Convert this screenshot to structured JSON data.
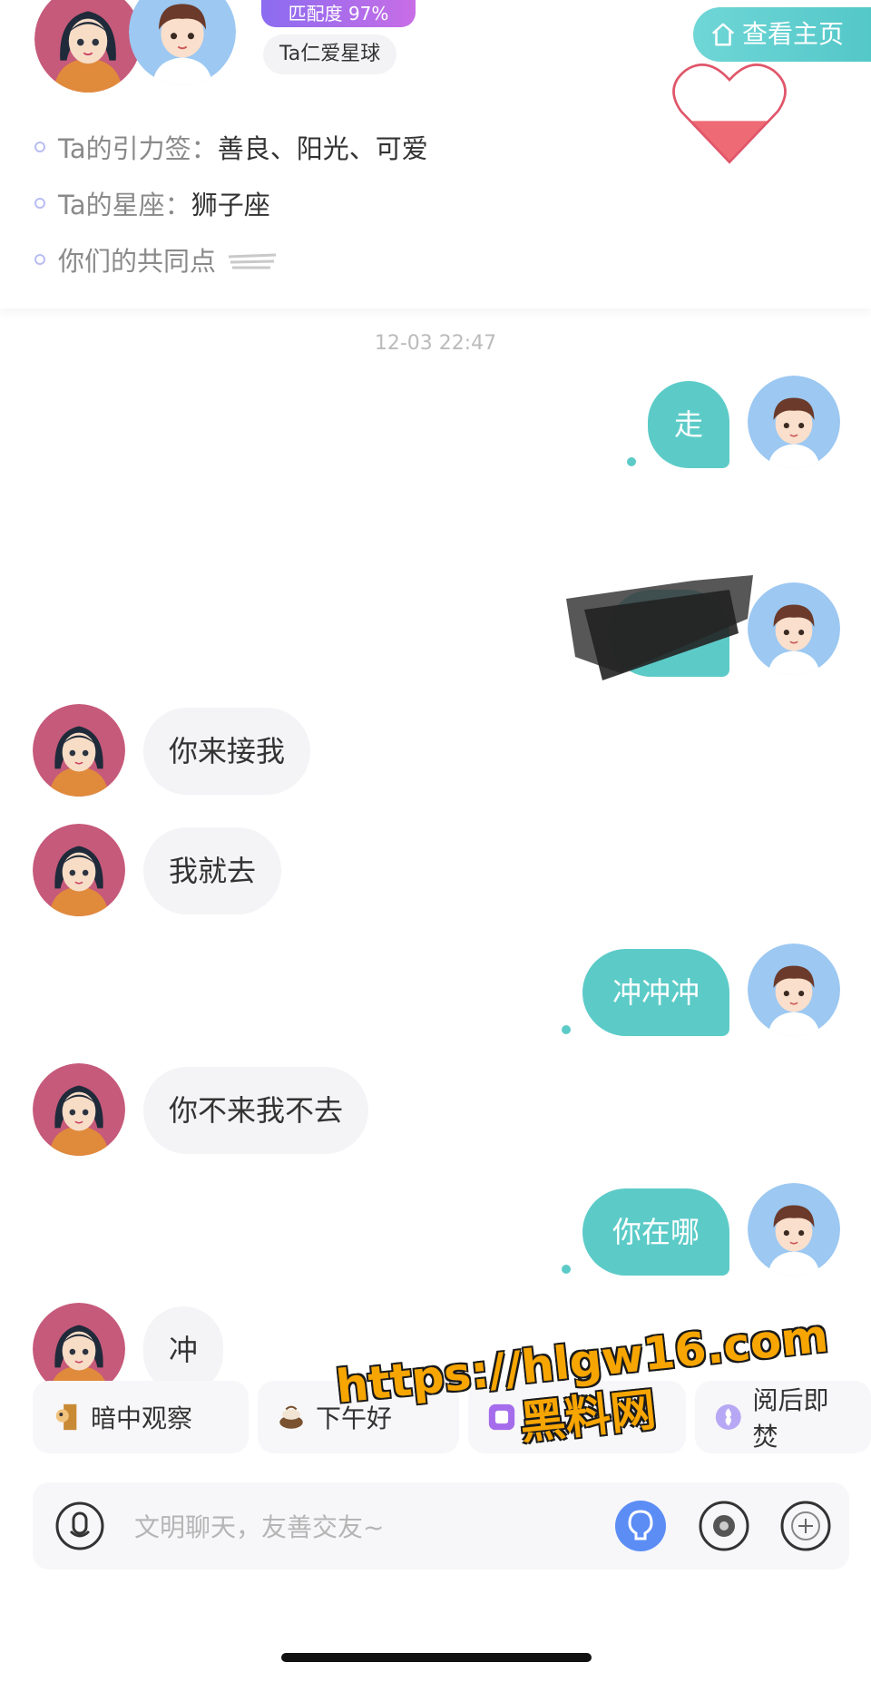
{
  "header": {
    "match_badge": "匹配度 97%",
    "planet_label": "Ta仁爱星球",
    "home_button_label": "查看主页",
    "home_icon": "home-icon",
    "heart_icon": "heart-icon"
  },
  "profile_info": [
    {
      "label": "Ta的引力签：",
      "value": "善良、阳光、可爱"
    },
    {
      "label": "Ta的星座：",
      "value": "狮子座"
    },
    {
      "label": "你们的共同点",
      "value": ""
    }
  ],
  "chat": {
    "timestamp": "12-03 22:47",
    "messages": [
      {
        "side": "right",
        "text": "走"
      },
      {
        "side": "right",
        "text": "",
        "redacted": true
      },
      {
        "side": "left",
        "text": "你来接我"
      },
      {
        "side": "left",
        "text": "我就去"
      },
      {
        "side": "right",
        "text": "冲冲冲"
      },
      {
        "side": "left",
        "text": "你不来我不去"
      },
      {
        "side": "right",
        "text": "你在哪"
      },
      {
        "side": "left",
        "text": "冲"
      }
    ]
  },
  "quick_replies": [
    {
      "label": "暗中观察",
      "icon": "peek-icon"
    },
    {
      "label": "下午好",
      "icon": "coffee-icon"
    },
    {
      "label": "",
      "icon": "purple-icon"
    },
    {
      "label": "阅后即焚",
      "icon": "burn-icon"
    }
  ],
  "input": {
    "placeholder": "文明聊天，友善交友~",
    "voice_icon": "microphone-icon",
    "ai_icon": "ai-bulb-icon",
    "sticker_icon": "sticker-icon",
    "more_icon": "more-icon"
  },
  "watermark": {
    "url": "https://hlgw16.com",
    "brand": "黑料网"
  },
  "colors": {
    "accent_teal": "#5ccbc8",
    "badge_purple": "#a56cec",
    "watermark_orange": "#f7a500"
  }
}
